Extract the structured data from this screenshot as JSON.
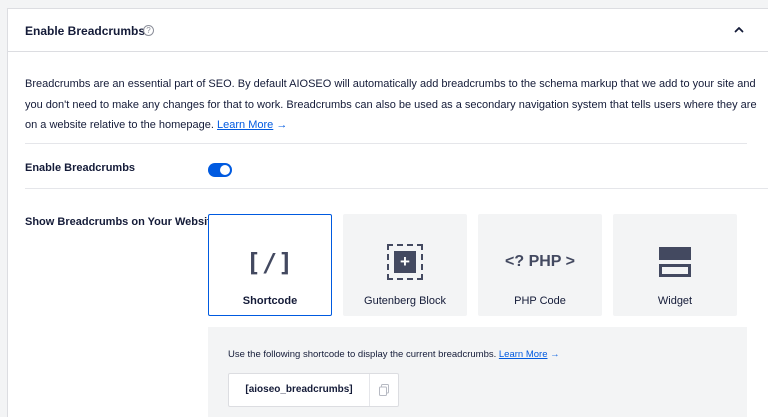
{
  "header": {
    "title": "Enable Breadcrumbs",
    "help_icon": "question-circle-icon",
    "collapse_icon": "chevron-up-icon"
  },
  "description": {
    "text": "Breadcrumbs are an essential part of SEO. By default AIOSEO will automatically add breadcrumbs to the schema markup that we add to your site and you don't need to make any changes for that to work. Breadcrumbs can also be used as a secondary navigation system that tells users where they are on a website relative to the homepage.",
    "link_label": "Learn More",
    "link_arrow": "→"
  },
  "enable_row": {
    "label": "Enable Breadcrumbs",
    "toggle_on": true
  },
  "display_row": {
    "label": "Show Breadcrumbs on Your Website",
    "options": [
      {
        "label": "Shortcode",
        "icon": "shortcode-icon",
        "glyph": "[/]",
        "selected": true
      },
      {
        "label": "Gutenberg Block",
        "icon": "gutenberg-block-icon",
        "glyph": "+",
        "selected": false
      },
      {
        "label": "PHP Code",
        "icon": "php-code-icon",
        "glyph": "<? PHP >",
        "selected": false
      },
      {
        "label": "Widget",
        "icon": "widget-icon",
        "glyph": "",
        "selected": false
      }
    ]
  },
  "shortcode_panel": {
    "text": "Use the following shortcode to display the current breadcrumbs.",
    "link_label": "Learn More",
    "link_arrow": "→",
    "shortcode": "[aioseo_breadcrumbs]",
    "copy_icon": "copy-icon"
  },
  "colors": {
    "accent": "#005ae0",
    "text": "#141b38",
    "panel_bg": "#f3f4f5",
    "border": "#dcdde1"
  }
}
